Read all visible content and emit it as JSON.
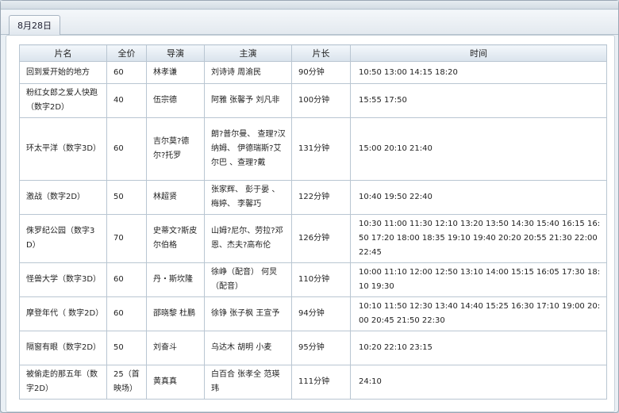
{
  "tab": {
    "label": "8月28日"
  },
  "table": {
    "headers": [
      "片名",
      "全价",
      "导演",
      "主演",
      "片长",
      "时间"
    ],
    "rows": [
      {
        "title": "回到爱开始的地方",
        "price": "60",
        "director": "林孝谦",
        "cast": "刘诗诗  周渝民",
        "length": "90分钟",
        "times": "10:50 13:00 14:15 18:20"
      },
      {
        "title": "粉红女郎之爱人快跑（数字2D）",
        "price": "40",
        "director": "伍宗德",
        "cast": "阿雅 张馨予 刘凡非",
        "length": "100分钟",
        "times": "15:55 17:50"
      },
      {
        "title": "环太平洋（数字3D）",
        "price": "60",
        "director": "吉尔莫?德尔?托罗",
        "cast": "朗?普尔曼、 查理?汉纳姆、 伊德瑞斯?艾尔巴 、查理?戴",
        "length": "131分钟",
        "times": "15:00 20:10 21:40"
      },
      {
        "title": "激战（数字2D）",
        "price": "50",
        "director": "林超贤",
        "cast": "张家辉、 彭于晏 、梅婷、 李馨巧",
        "length": "122分钟",
        "times": "10:40 19:50 22:40"
      },
      {
        "title": "侏罗纪公园（数字3D）",
        "price": "70",
        "director": "史蒂文?斯皮尔伯格",
        "cast": "山姆?尼尔、劳拉?邓恩、杰夫?高布伦",
        "length": "126分钟",
        "times": "10:30 11:00 11:30 12:10 13:20 13:50 14:30 15:40 16:15 16:50 17:20 18:00 18:35 19:10 19:40 20:20 20:55 21:30 22:00 22:45"
      },
      {
        "title": "怪兽大学（数字3D）",
        "price": "60",
        "director": "丹・斯坎隆",
        "cast": "徐峥（配音） 何炅（配音）",
        "length": "110分钟",
        "times": "10:00 11:10 12:00 12:50 13:10 14:00 15:15 16:05 17:30 18:10 19:30"
      },
      {
        "title": "摩登年代（ 数字2D）",
        "price": "60",
        "director": "邵晓黎 杜鹏",
        "cast": "徐铮 张子枫 王宣予",
        "length": "94分钟",
        "times": "10:10 11:50 12:30 13:40 14:40 15:25 16:30 17:10 19:00 20:00 20:45 21:50 22:30"
      },
      {
        "title": "隔窗有眼（数字2D）",
        "price": "50",
        "director": "刘奋斗",
        "cast": "乌达木 胡明 小麦",
        "length": "95分钟",
        "times": "10:20 22:10 23:15"
      },
      {
        "title": "被偷走的那五年（数字2D）",
        "price": "25（首映场）",
        "director": "黄真真",
        "cast": "白百合 张孝全 范瑛玮",
        "length": "111分钟",
        "times": "24:10"
      }
    ]
  }
}
